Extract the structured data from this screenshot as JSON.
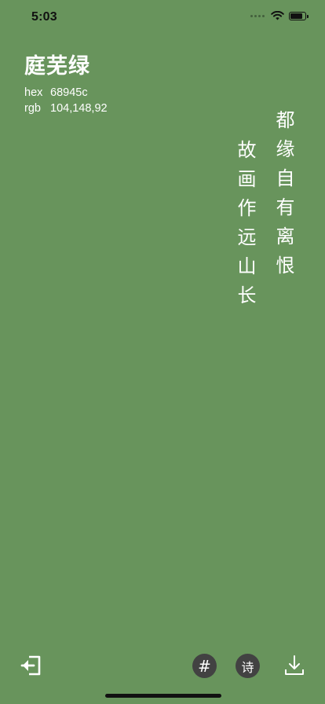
{
  "status_bar": {
    "time": "5:03",
    "battery_level": 0.9
  },
  "color": {
    "name": "庭芜绿",
    "hex_label": "hex",
    "hex_value": "68945c",
    "rgb_label": "rgb",
    "rgb_value": "104,148,92",
    "background": "#68945c"
  },
  "poem": {
    "lines": [
      "都缘自有离恨",
      "故画作远山长"
    ]
  },
  "toolbar": {
    "exit_icon": "exit-icon",
    "hash_label": "#",
    "poem_label": "诗",
    "download_icon": "download-icon"
  },
  "colors": {
    "button_bg": "#424242",
    "status_text": "#111111"
  }
}
